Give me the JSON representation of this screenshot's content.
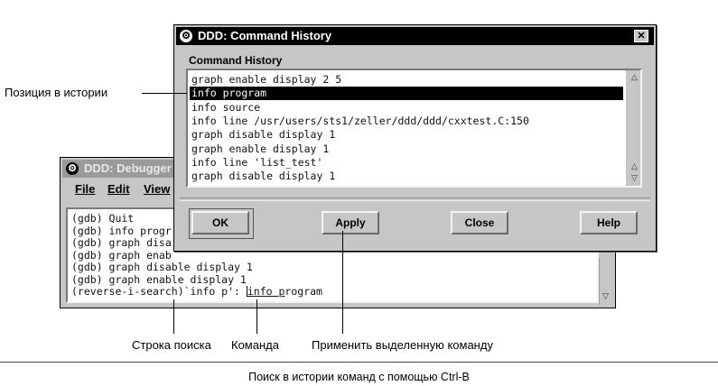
{
  "back_window": {
    "title": "DDD: Debugger",
    "menu": [
      "File",
      "Edit",
      "View"
    ],
    "console_lines": [
      "(gdb) Quit",
      "(gdb) info progr",
      "(gdb) graph disa",
      "(gdb) graph enab",
      "(gdb) graph disable display 1",
      "(gdb) graph enable display 1"
    ],
    "search_prefix": "(reverse-i-search)`info p': ",
    "search_match": "info p",
    "search_rest": "rogram"
  },
  "dialog": {
    "title": "DDD: Command History",
    "close_glyph": "✕",
    "list_label": "Command History",
    "history": [
      "graph enable display 2 5",
      "info program",
      "info source",
      "info line /usr/users/sts1/zeller/ddd/ddd/cxxtest.C:150",
      "graph disable display 1",
      "graph enable display 1",
      "info line 'list_test'",
      "graph disable display 1"
    ],
    "selected_index": 1,
    "buttons": {
      "ok": "OK",
      "apply": "Apply",
      "close": "Close",
      "help": "Help"
    },
    "scroll_up_glyph": "△",
    "scroll_down_glyph": "▽"
  },
  "annotations": {
    "history_position": "Позиция в истории",
    "search_line": "Строка поиска",
    "command": "Команда",
    "apply_selected": "Применить выделенную команду"
  },
  "caption": "Поиск в истории команд с помощью Ctrl-B",
  "icons": {
    "window_menu": "ddd-window-icon"
  }
}
